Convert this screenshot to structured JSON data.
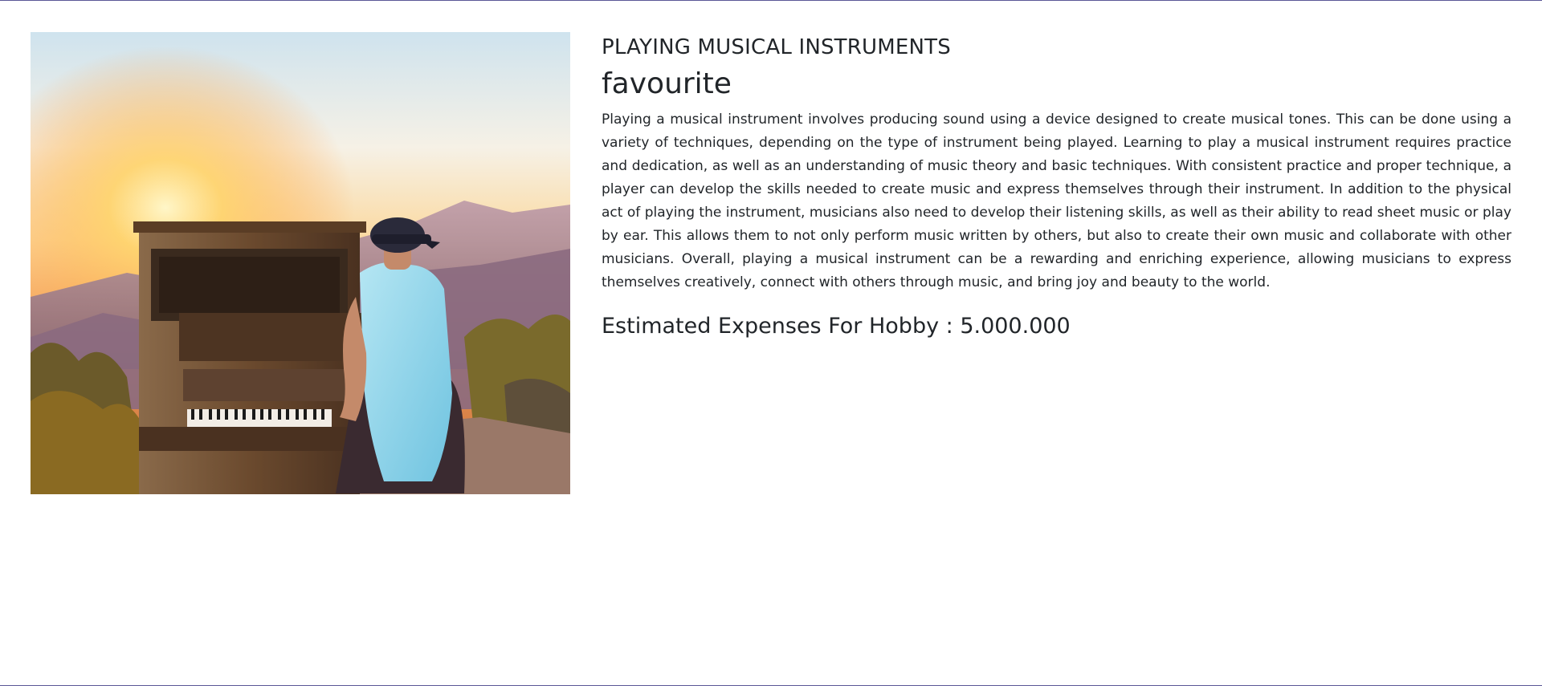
{
  "hobby": {
    "title": "PLAYING MUSICAL INSTRUMENTS",
    "tag": "favourite",
    "description": "Playing a musical instrument involves producing sound using a device designed to create musical tones. This can be done using a variety of techniques, depending on the type of instrument being played. Learning to play a musical instrument requires practice and dedication, as well as an understanding of music theory and basic techniques. With consistent practice and proper technique, a player can develop the skills needed to create music and express themselves through their instrument. In addition to the physical act of playing the instrument, musicians also need to develop their listening skills, as well as their ability to read sheet music or play by ear. This allows them to not only perform music written by others, but also to create their own music and collaborate with other musicians. Overall, playing a musical instrument can be a rewarding and enriching experience, allowing musicians to express themselves creatively, connect with others through music, and bring joy and beauty to the world.",
    "expenses": "Estimated Expenses For Hobby : 5.000.000"
  },
  "colors": {
    "frame_border": "#5a5796",
    "text": "#212529",
    "sky_top": "#cfe3ee",
    "sun": "#ffd36b",
    "mountain": "#9a7f96",
    "piano": "#6b4a2e",
    "shirt": "#8fd3ea"
  }
}
